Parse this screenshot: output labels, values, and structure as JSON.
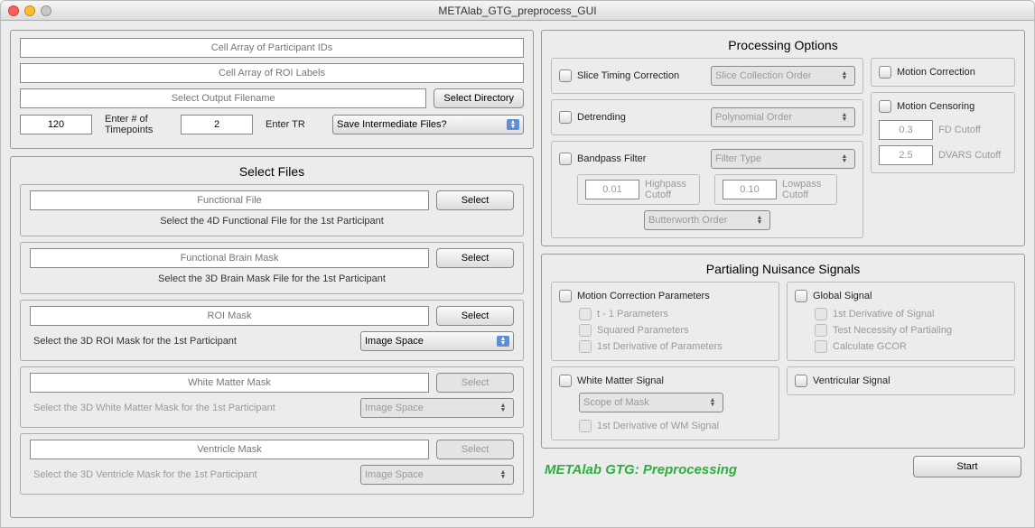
{
  "window": {
    "title": "METAlab_GTG_preprocess_GUI"
  },
  "top": {
    "participant_ids_placeholder": "Cell Array of Participant IDs",
    "roi_labels_placeholder": "Cell Array of ROI Labels",
    "output_filename_placeholder": "Select Output Filename",
    "select_directory": "Select Directory",
    "timepoints_value": "120",
    "timepoints_label": "Enter # of Timepoints",
    "tr_value": "2",
    "tr_label": "Enter TR",
    "save_intermediate": "Save Intermediate Files?"
  },
  "select_files": {
    "title": "Select Files",
    "select_btn": "Select",
    "image_space": "Image Space",
    "items": [
      {
        "field": "Functional File",
        "hint": "Select the 4D Functional File for the 1st Participant",
        "enabled": true,
        "has_space": false
      },
      {
        "field": "Functional Brain Mask",
        "hint": "Select the 3D Brain Mask File for the 1st Participant",
        "enabled": true,
        "has_space": false
      },
      {
        "field": "ROI Mask",
        "hint": "Select the 3D ROI Mask for the 1st Participant",
        "enabled": true,
        "has_space": true,
        "space_enabled": true
      },
      {
        "field": "White Matter Mask",
        "hint": "Select the 3D White Matter Mask for the 1st Participant",
        "enabled": false,
        "has_space": true,
        "space_enabled": false
      },
      {
        "field": "Ventricle Mask",
        "hint": "Select the 3D Ventricle Mask for the 1st Participant",
        "enabled": false,
        "has_space": true,
        "space_enabled": false
      }
    ]
  },
  "processing": {
    "title": "Processing Options",
    "slice_timing": "Slice Timing Correction",
    "slice_order": "Slice Collection Order",
    "detrending": "Detrending",
    "poly_order": "Polynomial Order",
    "bandpass": "Bandpass Filter",
    "filter_type": "Filter Type",
    "highpass_val": "0.01",
    "highpass_label": "Highpass Cutoff",
    "lowpass_val": "0.10",
    "lowpass_label": "Lowpass Cutoff",
    "butter": "Butterworth Order",
    "motion_corr": "Motion Correction",
    "motion_cens": "Motion Censoring",
    "fd_val": "0.3",
    "fd_label": "FD Cutoff",
    "dvars_val": "2.5",
    "dvars_label": "DVARS Cutoff"
  },
  "pns": {
    "title": "Partialing Nuisance Signals",
    "mcp": "Motion Correction Parameters",
    "mcp_sub": [
      "t - 1 Parameters",
      "Squared Parameters",
      "1st Derivative of Parameters"
    ],
    "wm": "White Matter Signal",
    "wm_scope": "Scope of Mask",
    "wm_deriv": "1st Derivative of WM Signal",
    "global": "Global Signal",
    "global_sub": [
      "1st Derivative of Signal",
      "Test Necessity of Partialing",
      "Calculate GCOR"
    ],
    "ventricular": "Ventricular Signal"
  },
  "footer": {
    "brand": "METAlab GTG: Preprocessing",
    "start": "Start"
  }
}
